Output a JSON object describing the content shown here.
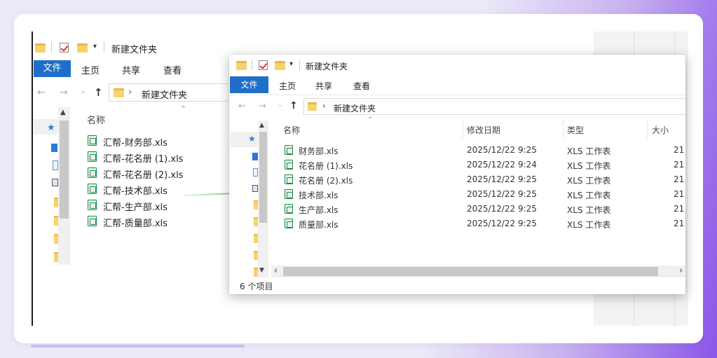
{
  "colors": {
    "accent": "#1f6fc8",
    "arrow": "#28b43c",
    "excel_green": "#1e8a4c"
  },
  "back_window": {
    "title": "新建文件夹",
    "ribbon": {
      "tabs": [
        "文件",
        "主页",
        "共享",
        "查看"
      ]
    },
    "address": {
      "path": "新建文件夹"
    },
    "column_name": "名称",
    "files": [
      "汇帮-财务部.xls",
      "汇帮-花名册 (1).xls",
      "汇帮-花名册 (2).xls",
      "汇帮-技术部.xls",
      "汇帮-生产部.xls",
      "汇帮-质量部.xls"
    ]
  },
  "front_window": {
    "title": "新建文件夹",
    "ribbon": {
      "tabs": [
        "文件",
        "主页",
        "共享",
        "查看"
      ]
    },
    "address": {
      "path": "新建文件夹"
    },
    "columns": {
      "name": "名称",
      "modified": "修改日期",
      "type": "类型",
      "size": "大小"
    },
    "rows": [
      {
        "name": "财务部.xls",
        "modified": "2025/12/22 9:25",
        "type": "XLS 工作表",
        "size": "21"
      },
      {
        "name": "花名册 (1).xls",
        "modified": "2025/12/22 9:24",
        "type": "XLS 工作表",
        "size": "21"
      },
      {
        "name": "花名册 (2).xls",
        "modified": "2025/12/22 9:25",
        "type": "XLS 工作表",
        "size": "21"
      },
      {
        "name": "技术部.xls",
        "modified": "2025/12/22 9:25",
        "type": "XLS 工作表",
        "size": "21"
      },
      {
        "name": "生产部.xls",
        "modified": "2025/12/22 9:25",
        "type": "XLS 工作表",
        "size": "21"
      },
      {
        "name": "质量部.xls",
        "modified": "2025/12/22 9:25",
        "type": "XLS 工作表",
        "size": "21"
      }
    ],
    "status": "6 个项目"
  }
}
